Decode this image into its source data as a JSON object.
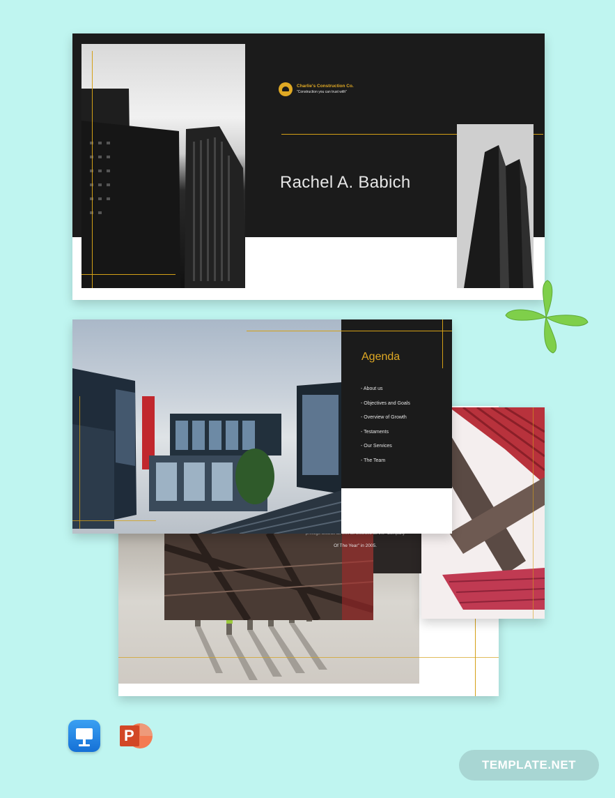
{
  "slide1": {
    "company": "Charlie's Construction Co.",
    "tagline": "\"Construction you can trust with\"",
    "name": "Rachel A. Babich"
  },
  "slide2": {
    "agenda_title": "Agenda",
    "agenda_items": [
      "About us",
      "Objectives and Goals",
      "Overview of Growth",
      "Testaments",
      "Our Services",
      "The Team"
    ]
  },
  "slide3": {
    "text_line1": "prestige awards as well as awarded as the \"Company",
    "text_line2": "Of The Year\" in 2005."
  },
  "icons": {
    "keynote": "keynote-icon",
    "powerpoint": "powerpoint-icon",
    "powerpoint_letter": "P"
  },
  "badge": {
    "brand": "TEMPLATE",
    "suffix": ".NET"
  },
  "colors": {
    "background": "#bff5f0",
    "accent_gold": "#e0a924",
    "slide_dark": "#1b1b1b"
  }
}
